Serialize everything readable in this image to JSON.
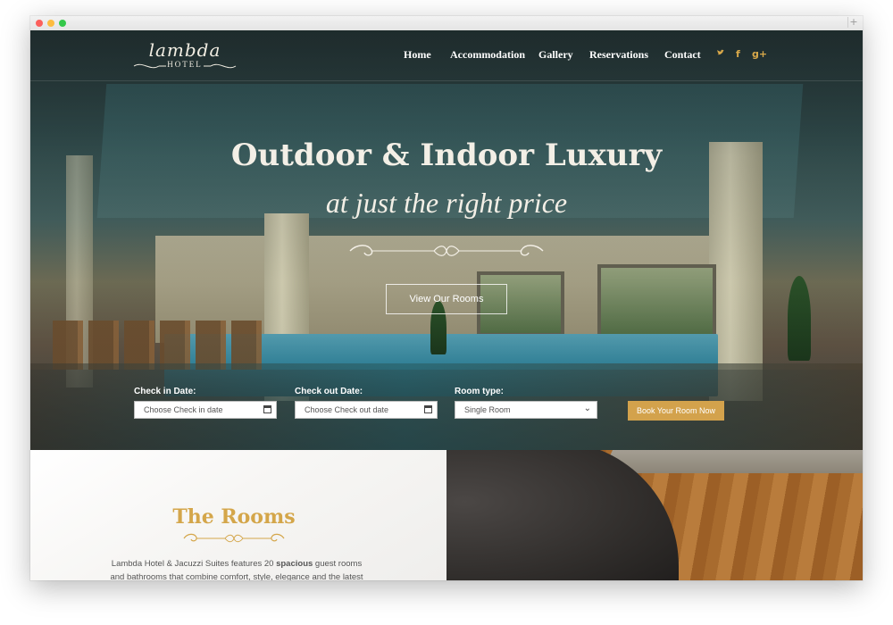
{
  "logo": {
    "script": "lambda",
    "sub": "HOTEL"
  },
  "nav": {
    "items": [
      "Home",
      "Accommodation",
      "Gallery",
      "Reservations",
      "Contact"
    ]
  },
  "social": {
    "twitter": "twitter-icon",
    "facebook": "facebook-icon",
    "google_plus": "google-plus-icon"
  },
  "hero": {
    "title": "Outdoor & Indoor Luxury",
    "subtitle": "at just the right price",
    "button": "View Our Rooms"
  },
  "booking": {
    "checkin_label": "Check in Date:",
    "checkin_placeholder": "Choose Check in date",
    "checkout_label": "Check out Date:",
    "checkout_placeholder": "Choose Check out date",
    "room_label": "Room type:",
    "room_value": "Single Room",
    "book_button": "Book Your Room Now"
  },
  "rooms": {
    "title": "The Rooms",
    "text_before": "Lambda Hotel & Jacuzzi Suites features 20 ",
    "text_bold": "spacious",
    "text_after": " guest rooms and bathrooms that combine comfort, style, elegance and the latest"
  },
  "colors": {
    "accent": "#d3a24c",
    "text_light": "#f3efe6"
  }
}
